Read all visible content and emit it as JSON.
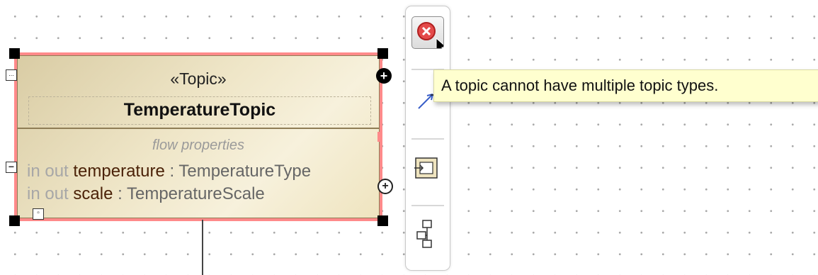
{
  "block": {
    "stereotype": "«Topic»",
    "name": "TemperatureTopic",
    "compartment_title": "flow properties",
    "properties": [
      {
        "direction": "in out",
        "name": "temperature",
        "type": " : TemperatureType"
      },
      {
        "direction": "in out",
        "name": "scale",
        "type": " : TemperatureScale"
      }
    ],
    "border_color": "#ff8a8a",
    "fill_color": "#efe6c8"
  },
  "toolbar": {
    "error_icon": "red-error-x-icon",
    "tools": [
      "relationship-arrow-icon",
      "insert-element-icon",
      "structure-icon"
    ]
  },
  "tooltip": {
    "text": "A topic cannot have multiple topic types.",
    "background": "#ffffcf"
  },
  "icons": {
    "expand_marker": "...",
    "collapse_marker": "−"
  }
}
